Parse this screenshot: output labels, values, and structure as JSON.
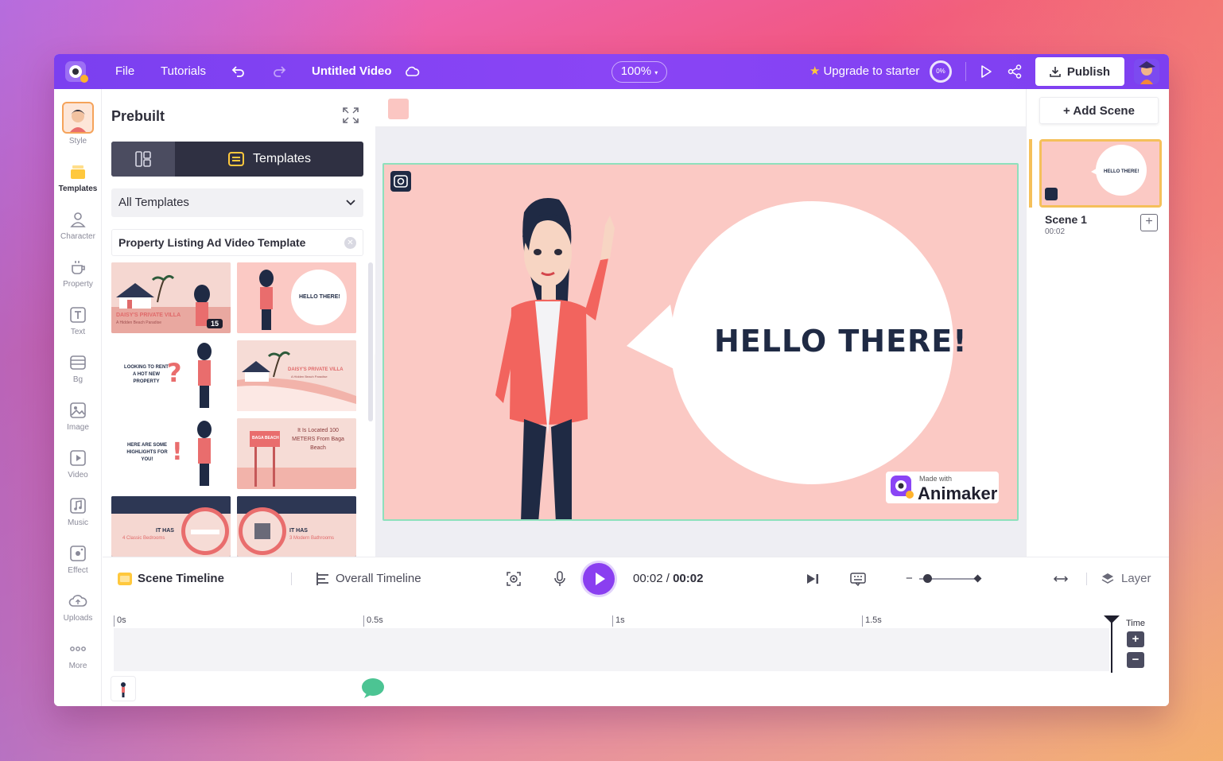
{
  "topbar": {
    "file": "File",
    "tutorials": "Tutorials",
    "title": "Untitled Video",
    "zoom": "100%",
    "upgrade": "Upgrade to starter",
    "progress_pct": "0%",
    "publish": "Publish"
  },
  "rail": {
    "style": "Style",
    "templates": "Templates",
    "character": "Character",
    "property": "Property",
    "text": "Text",
    "bg": "Bg",
    "image": "Image",
    "video": "Video",
    "music": "Music",
    "effect": "Effect",
    "uploads": "Uploads",
    "more": "More"
  },
  "panel": {
    "title": "Prebuilt",
    "tab_templates": "Templates",
    "select_value": "All Templates",
    "search_tag": "Property Listing Ad Video Template",
    "thumbs": [
      {
        "caption": "DAISY'S PRIVATE VILLA",
        "sub": "A Hidden Beach Paradise",
        "badge": "15"
      },
      {
        "caption": "HELLO THERE!"
      },
      {
        "caption": "LOOKING TO RENT A HOT NEW PROPERTY"
      },
      {
        "caption": "DAISY'S PRIVATE VILLA",
        "sub": "A Hidden Beach Paradise"
      },
      {
        "caption": "HERE ARE SOME HIGHLIGHTS FOR YOU!"
      },
      {
        "caption": "It Is Located 100 METERS From Baga Beach",
        "sign": "BAGA BEACH"
      },
      {
        "caption": "IT HAS",
        "sub": "4 Classic Bedrooms"
      },
      {
        "caption": "IT HAS",
        "sub": "3 Modern Bathrooms"
      }
    ]
  },
  "stage": {
    "speech": "HELLO THERE!",
    "made_with": "Made with",
    "brand": "Animaker"
  },
  "scenes": {
    "add": "+ Add Scene",
    "items": [
      {
        "name": "Scene 1",
        "duration": "00:02",
        "speech": "HELLO THERE!"
      }
    ]
  },
  "timeline": {
    "scene_tab": "Scene Timeline",
    "overall_tab": "Overall Timeline",
    "current": "00:02",
    "total": "00:02",
    "layer": "Layer",
    "ticks": [
      "0s",
      "0.5s",
      "1s",
      "1.5s"
    ],
    "time_label": "Time"
  },
  "colors": {
    "accent": "#8a45f5",
    "stage_bg": "#fbc9c4",
    "active_scene": "#f5c05a"
  }
}
